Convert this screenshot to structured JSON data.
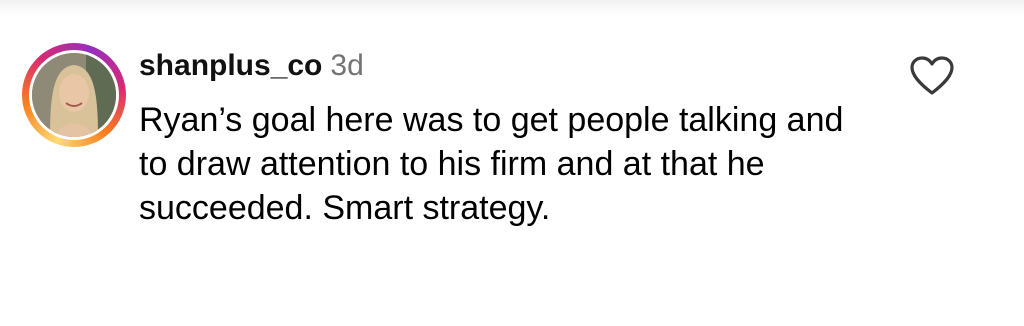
{
  "comment": {
    "username": "shanplus_co",
    "timestamp": "3d",
    "text": "Ryan’s goal here was to get people talking and to draw attention to his firm and at that he succeeded. Smart strategy."
  },
  "icons": {
    "like": "heart-outline-icon",
    "avatar": "profile-photo"
  },
  "colors": {
    "timestamp": "#737373",
    "ring_start": "#feda75",
    "ring_mid": "#d62976",
    "ring_end": "#962fbf"
  }
}
